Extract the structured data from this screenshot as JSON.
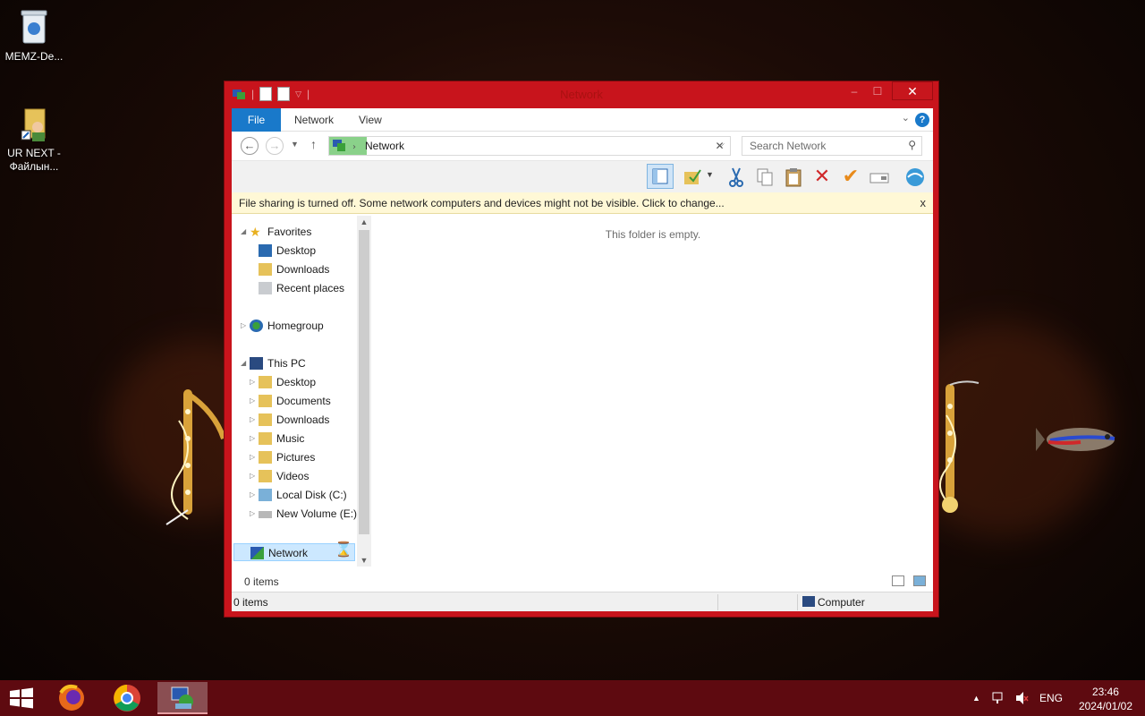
{
  "desktop": {
    "icons": [
      {
        "label": "MEMZ-De..."
      },
      {
        "label": "UR NEXT - Файлын..."
      }
    ]
  },
  "window": {
    "title": "Network",
    "close_glyph": "✕",
    "minimize_glyph": "–",
    "maximize_glyph": "☐",
    "ribbon_tabs": [
      "File",
      "Network",
      "View"
    ],
    "help_glyph": "?",
    "address": {
      "path": "Network",
      "separator": "›"
    },
    "search_placeholder": "Search Network",
    "info_bar": "File sharing is turned off. Some network computers and devices might not be visible. Click to change...",
    "info_close": "x",
    "navigation": {
      "favorites": {
        "label": "Favorites",
        "items": [
          "Desktop",
          "Downloads",
          "Recent places"
        ]
      },
      "homegroup": "Homegroup",
      "this_pc": {
        "label": "This PC",
        "items": [
          "Desktop",
          "Documents",
          "Downloads",
          "Music",
          "Pictures",
          "Videos",
          "Local Disk (C:)",
          "New Volume (E:)"
        ]
      },
      "network": "Network"
    },
    "content_empty_message": "This folder is empty.",
    "status_items": "0 items",
    "details_items": "0 items",
    "details_zone": "Computer"
  },
  "taskbar": {
    "tray_language": "ENG",
    "tray_up_glyph": "▲",
    "clock_time": "23:46",
    "clock_date": "2024/01/02"
  },
  "colors": {
    "window_border": "#c8141c",
    "accent": "#1979ca",
    "taskbar": "#5e0a10",
    "info_bar": "#fff8d6"
  }
}
